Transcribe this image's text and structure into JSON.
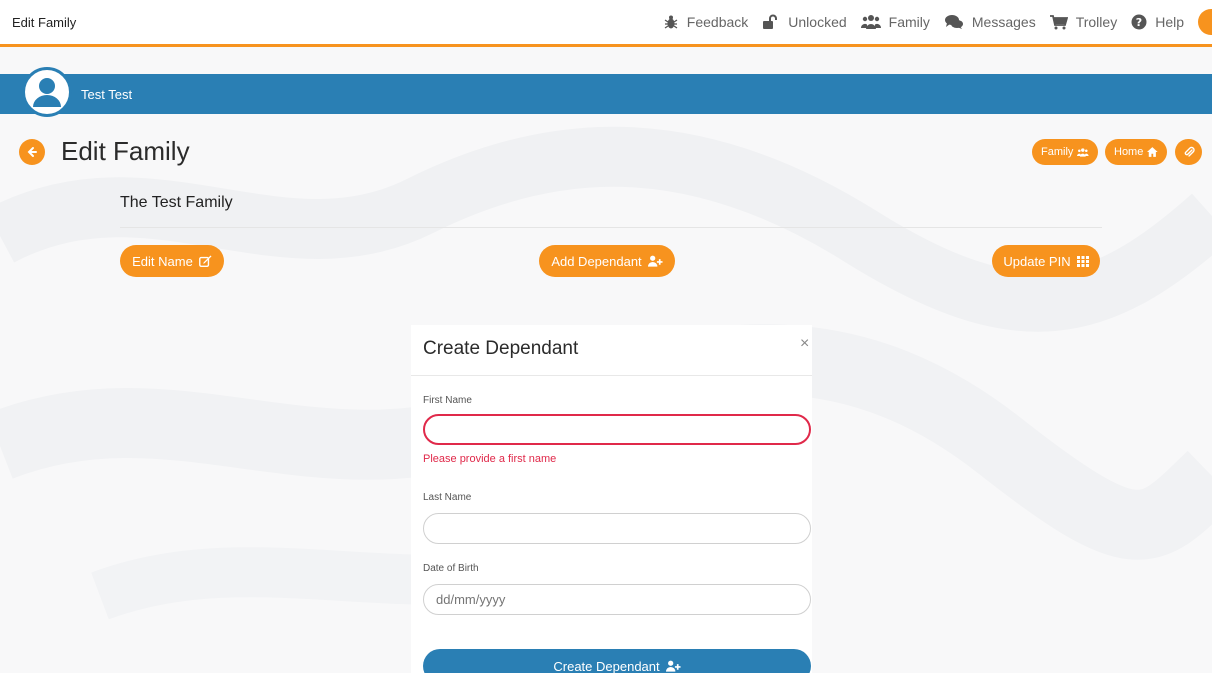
{
  "topbar": {
    "title": "Edit Family",
    "nav": [
      {
        "label": "Feedback",
        "icon": "bug-icon"
      },
      {
        "label": "Unlocked",
        "icon": "unlock-icon"
      },
      {
        "label": "Family",
        "icon": "users-icon"
      },
      {
        "label": "Messages",
        "icon": "comments-icon"
      },
      {
        "label": "Trolley",
        "icon": "cart-icon"
      },
      {
        "label": "Help",
        "icon": "question-circle-icon"
      }
    ]
  },
  "banner": {
    "user_name": "Test Test"
  },
  "page": {
    "title": "Edit Family",
    "quick_links": {
      "family": "Family",
      "home": "Home"
    },
    "family_name": "The Test Family",
    "actions": {
      "edit_name": "Edit Name",
      "add_dependant": "Add Dependant",
      "update_pin": "Update PIN"
    }
  },
  "modal": {
    "title": "Create Dependant",
    "close": "×",
    "first_name": {
      "label": "First Name",
      "value": "",
      "error": "Please provide a first name"
    },
    "last_name": {
      "label": "Last Name",
      "value": ""
    },
    "dob": {
      "label": "Date of Birth",
      "placeholder": "dd/mm/yyyy"
    },
    "submit": "Create Dependant"
  },
  "colors": {
    "accent": "#f7931e",
    "brand_blue": "#2a7fb4",
    "error": "#e0294a"
  }
}
